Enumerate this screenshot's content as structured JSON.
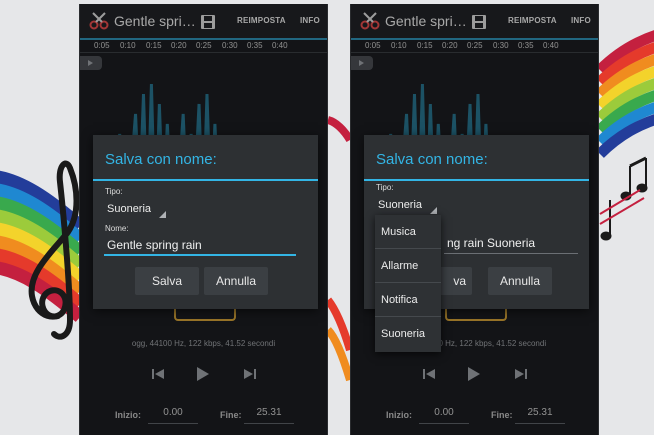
{
  "colors": {
    "accent": "#33b5e5",
    "marker": "#d4a338",
    "wave": "#2d8fb0",
    "screen_bg": "#1b1d20"
  },
  "left_screen": {
    "app_title": "Gentle spri…",
    "actions": {
      "save_icon": "floppy-save-icon",
      "reset_label": "REIMPOSTA",
      "info_label": "INFO"
    },
    "time_ticks": [
      "0:05",
      "0:10",
      "0:15",
      "0:20",
      "0:25",
      "0:30",
      "0:35",
      "0:40"
    ],
    "file_info": "ogg, 44100 Hz, 122 kbps, 41.52 secondi",
    "start_label": "Inizio:",
    "start_value": "0.00",
    "end_label": "Fine:",
    "end_value": "25.31",
    "dialog": {
      "title": "Salva con nome:",
      "type_label": "Tipo:",
      "type_value": "Suoneria",
      "name_label": "Nome:",
      "name_value": "Gentle spring rain",
      "save_button": "Salva",
      "cancel_button": "Annulla"
    }
  },
  "right_screen": {
    "app_title": "Gentle spri…",
    "actions": {
      "save_icon": "floppy-save-icon",
      "reset_label": "REIMPOSTA",
      "info_label": "INFO"
    },
    "time_ticks": [
      "0:05",
      "0:10",
      "0:15",
      "0:20",
      "0:25",
      "0:30",
      "0:35",
      "0:40"
    ],
    "file_info": "ogg, 44100 Hz, 122 kbps, 41.52 secondi",
    "start_label": "Inizio:",
    "start_value": "0.00",
    "end_label": "Fine:",
    "end_value": "25.31",
    "dialog": {
      "title": "Salva con nome:",
      "type_label": "Tipo:",
      "type_value": "Suoneria",
      "name_value_visible": "ng rain Suoneria",
      "save_button_visible": "va",
      "cancel_button": "Annulla"
    },
    "dropdown_options": [
      "Musica",
      "Allarme",
      "Notifica",
      "Suoneria"
    ]
  }
}
